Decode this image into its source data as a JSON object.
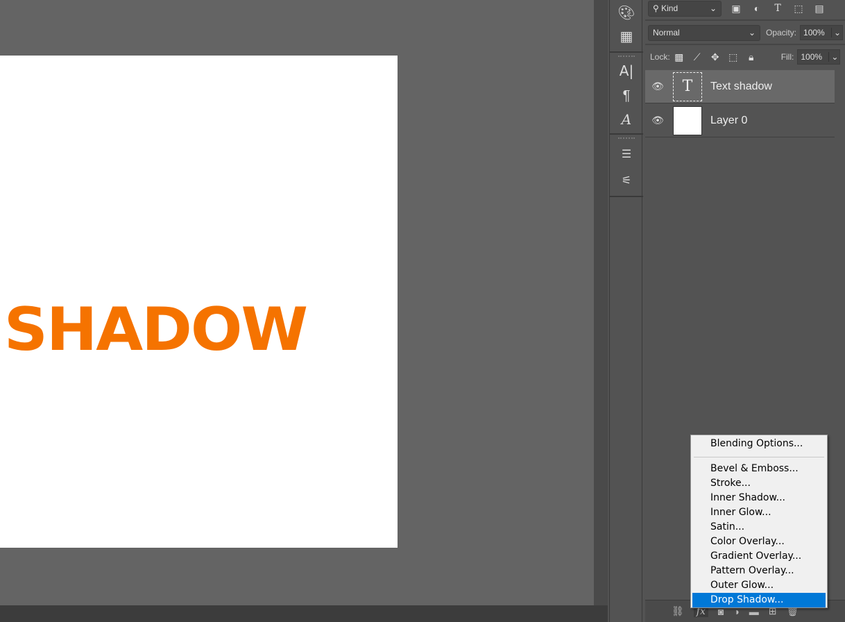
{
  "canvas": {
    "text": "SHADOW",
    "text_color": "#f57300"
  },
  "filter": {
    "kind": "Kind"
  },
  "blend": {
    "mode": "Normal",
    "opacity_label": "Opacity:",
    "opacity": "100%"
  },
  "lock": {
    "label": "Lock:",
    "fill_label": "Fill:",
    "fill": "100%"
  },
  "layers": [
    {
      "name": "Text shadow",
      "thumb": "T"
    },
    {
      "name": "Layer 0"
    }
  ],
  "context_menu": {
    "items": [
      "Blending Options...",
      "Bevel & Emboss...",
      "Stroke...",
      "Inner Shadow...",
      "Inner Glow...",
      "Satin...",
      "Color Overlay...",
      "Gradient Overlay...",
      "Pattern Overlay...",
      "Outer Glow...",
      "Drop Shadow..."
    ],
    "highlighted": "Drop Shadow...",
    "highlight_color": "#0078d7"
  },
  "bottom": {
    "fx": "fx"
  }
}
